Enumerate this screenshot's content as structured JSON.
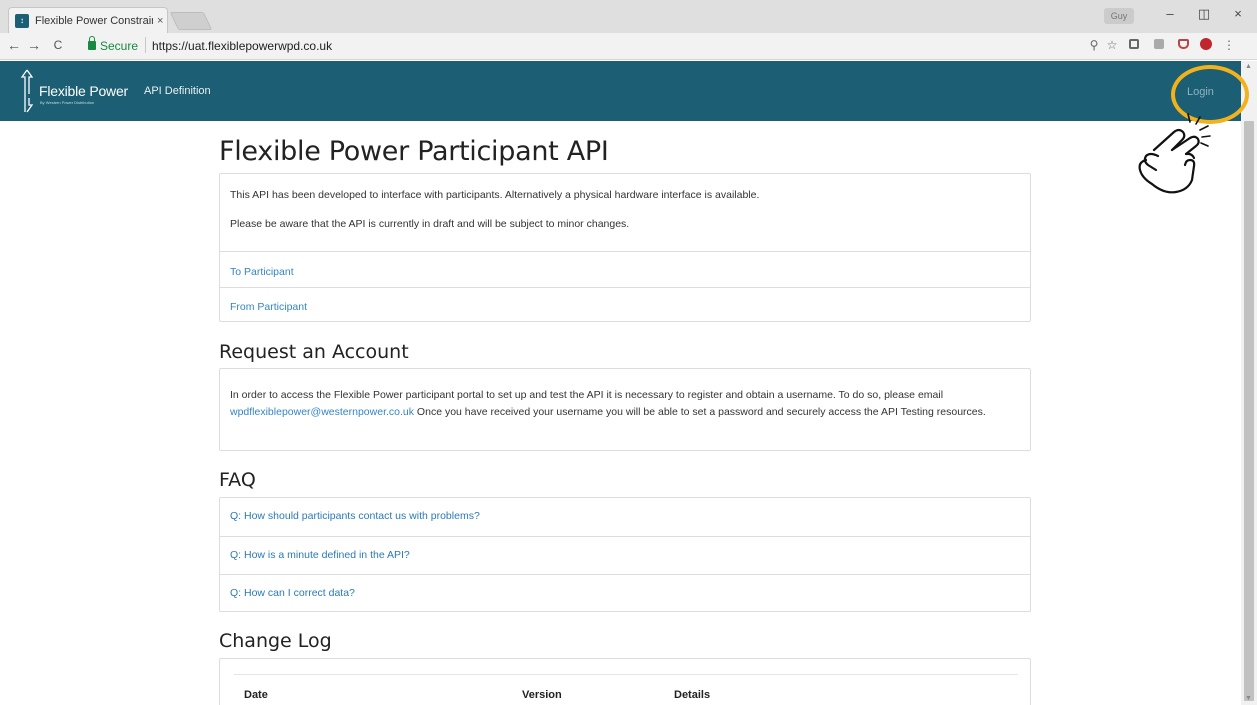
{
  "browser": {
    "tab_title": "Flexible Power Constrain",
    "tab_close": "×",
    "user_badge": "Guy",
    "window_controls": {
      "minimize": "–",
      "restore": "◫",
      "close": "×"
    },
    "nav": {
      "back": "←",
      "forward": "→",
      "reload": "C"
    },
    "secure_label": "Secure",
    "url": "https://uat.flexiblepowerwpd.co.uk",
    "toolbar_icons": [
      "zoom-icon",
      "star-icon",
      "extension-icon",
      "extension-icon",
      "pocket-icon",
      "adblock-icon",
      "menu-icon"
    ]
  },
  "header": {
    "brand": "Flexible Power",
    "brand_sub": "By Western Power Distribution",
    "nav_api": "API Definition",
    "nav_login": "Login",
    "background": "#1c5e74"
  },
  "main": {
    "title": "Flexible Power Participant API",
    "intro": {
      "line1": "This API has been developed to interface with participants. Alternatively a physical hardware interface is available.",
      "line2": "Please be aware that the API is currently in draft and will be subject to minor changes."
    },
    "links": {
      "to_participant": "To Participant",
      "from_participant": "From Participant"
    },
    "account": {
      "heading": "Request an Account",
      "text_before": "In order to access the Flexible Power participant portal to set up and test the API it is necessary to register and obtain a username. To do so, please email ",
      "email": "wpdflexiblepower@westernpower.co.uk",
      "text_after": " Once you have received your username you will be able to set a password and securely access the API Testing resources."
    },
    "faq": {
      "heading": "FAQ",
      "items": [
        "Q: How should participants contact us with problems?",
        "Q: How is a minute defined in the API?",
        "Q: How can I correct data?"
      ]
    },
    "changelog": {
      "heading": "Change Log",
      "columns": [
        "Date",
        "Version",
        "Details"
      ]
    }
  },
  "annotation": {
    "ring_color": "#f2b21b",
    "pointer": "hand-pointer-icon"
  }
}
